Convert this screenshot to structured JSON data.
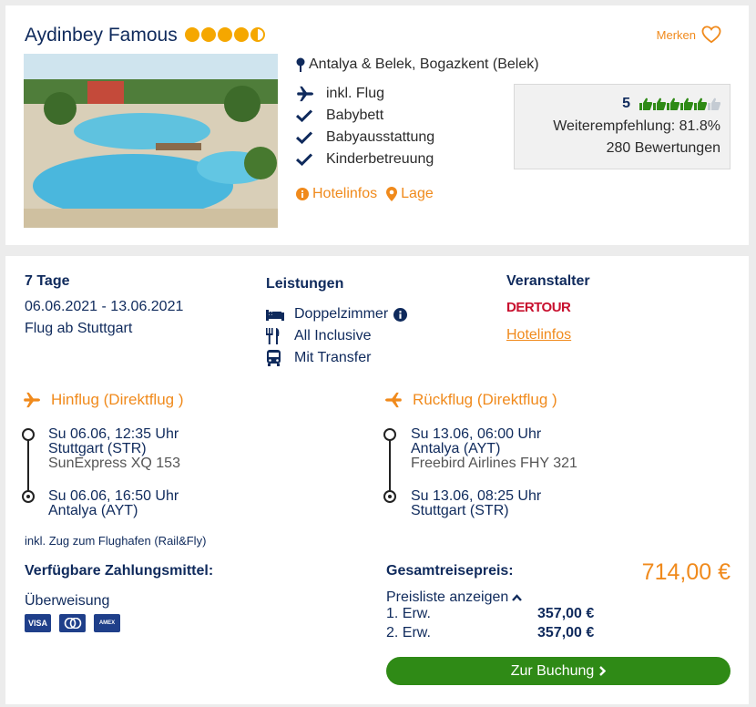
{
  "hotel": {
    "name": "Aydinbey Famous",
    "stars": 4.5,
    "merken_label": "Merken",
    "location": "Antalya & Belek, Bogazkent (Belek)",
    "features": [
      {
        "icon": "plane-icon",
        "label": "inkl. Flug"
      },
      {
        "icon": "check-icon",
        "label": "Babybett"
      },
      {
        "icon": "check-icon",
        "label": "Babyausstattung"
      },
      {
        "icon": "check-icon",
        "label": "Kinderbetreuung"
      }
    ],
    "links": {
      "hotelinfos": "Hotelinfos",
      "lage": "Lage"
    },
    "rating": {
      "score": "5",
      "thumbs_filled": 5,
      "thumbs_total": 6,
      "recommendation": "Weiterempfehlung: 81.8%",
      "reviews": "280 Bewertungen"
    }
  },
  "offer": {
    "duration": "7 Tage",
    "dates": "06.06.2021 - 13.06.2021",
    "departure": "Flug ab Stuttgart",
    "services_title": "Leistungen",
    "services": [
      {
        "icon": "bed-icon",
        "label": "Doppelzimmer"
      },
      {
        "icon": "cutlery-icon",
        "label": "All Inclusive"
      },
      {
        "icon": "bus-icon",
        "label": "Mit Transfer"
      }
    ],
    "operator_title": "Veranstalter",
    "operator_logo": "DERTOUR",
    "operator_link": "Hotelinfos"
  },
  "outbound": {
    "title": "Hinflug (Direktflug )",
    "dep_time": "Su 06.06, 12:35 Uhr",
    "dep_airport": "Stuttgart (STR)",
    "airline": "SunExpress XQ 153",
    "arr_time": "Su 06.06, 16:50 Uhr",
    "arr_airport": "Antalya (AYT)"
  },
  "return": {
    "title": "Rückflug (Direktflug )",
    "dep_time": "Su 13.06, 06:00 Uhr",
    "dep_airport": "Antalya (AYT)",
    "airline": "Freebird Airlines FHY 321",
    "arr_time": "Su 13.06, 08:25 Uhr",
    "arr_airport": "Stuttgart (STR)"
  },
  "rail_note": "inkl. Zug zum Flughafen (Rail&Fly)",
  "payment": {
    "title": "Verfügbare Zahlungsmittel:",
    "method": "Überweisung",
    "cards": [
      "VISA",
      "MC",
      "AMEX"
    ]
  },
  "pricing": {
    "label": "Gesamtreisepreis:",
    "total": "714,00 €",
    "toggle": "Preisliste anzeigen",
    "rows": [
      {
        "label": "1. Erw.",
        "value": "357,00 €"
      },
      {
        "label": "2. Erw.",
        "value": "357,00 €"
      }
    ],
    "button": "Zur Buchung"
  },
  "colors": {
    "orange": "#f08a1c",
    "navy": "#0f2a5c",
    "green": "#2f8a16"
  }
}
